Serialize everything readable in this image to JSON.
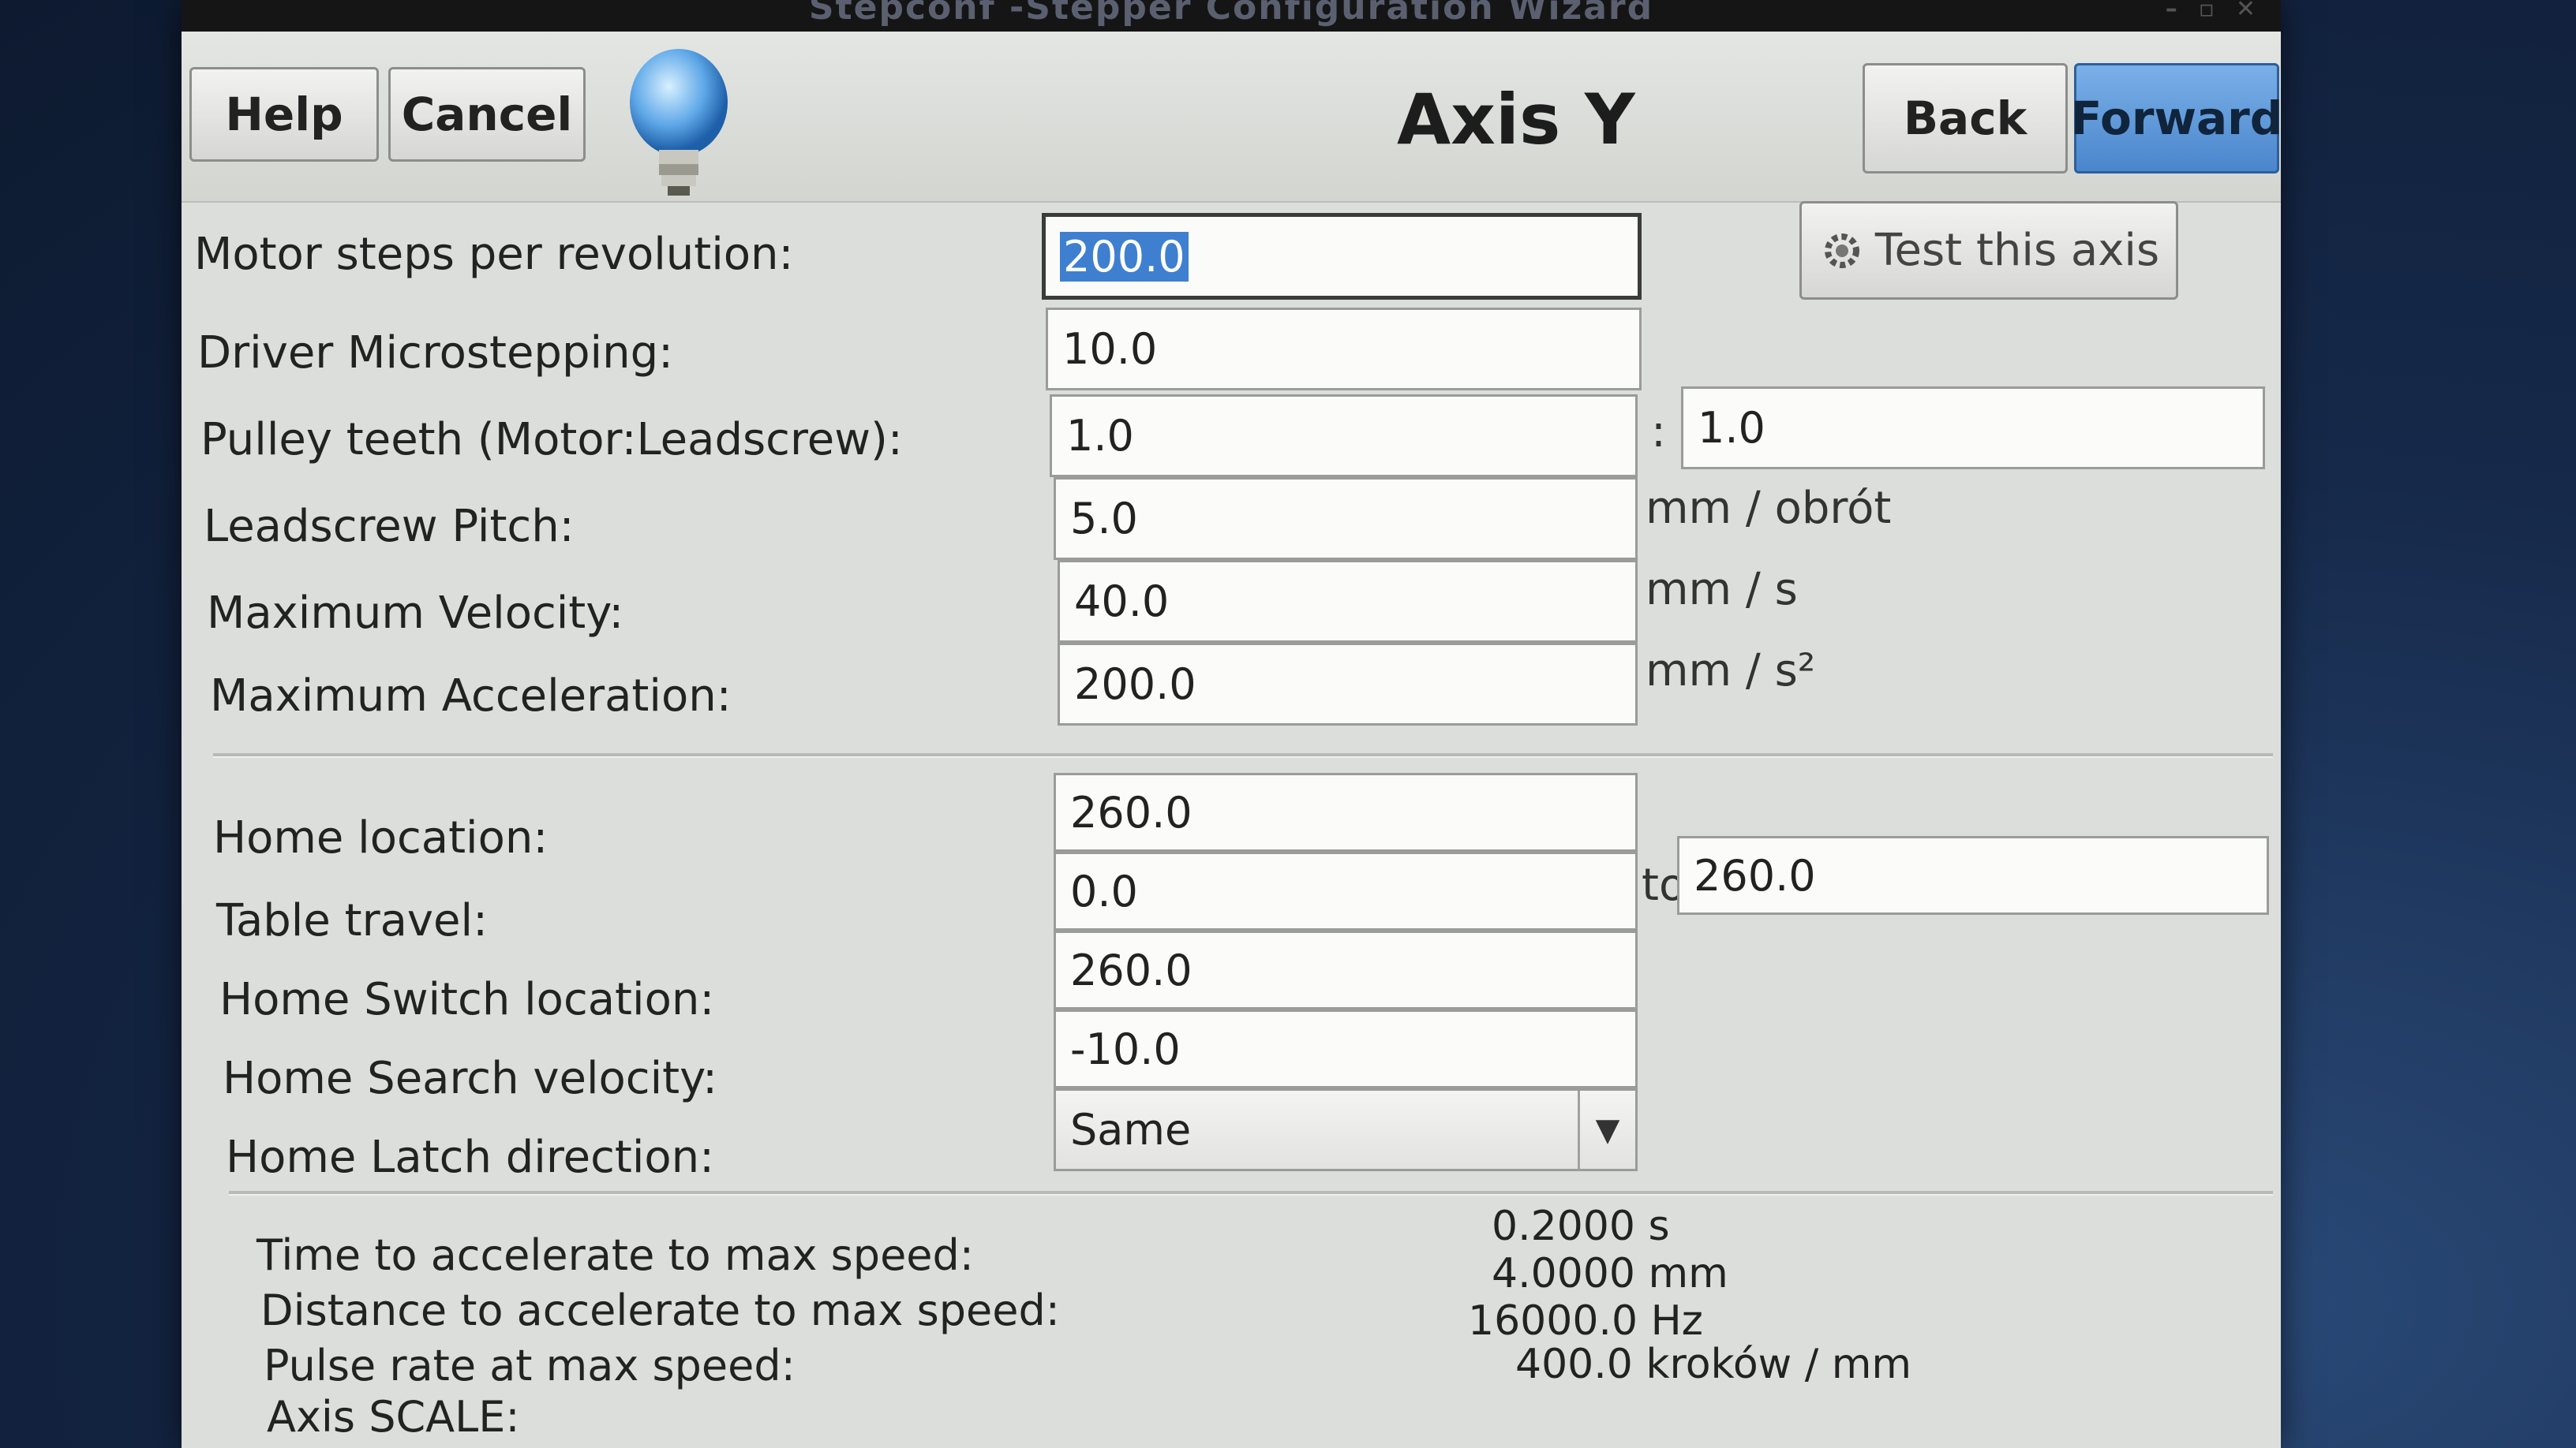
{
  "window": {
    "title": "Stepconf -Stepper Configuration Wizard",
    "controls": [
      "–",
      "▫",
      "✕"
    ]
  },
  "toolbar": {
    "help_label": "Help",
    "cancel_label": "Cancel",
    "page_title": "Axis Y",
    "back_label": "Back",
    "forward_label": "Forward",
    "test_axis_label": "Test this axis"
  },
  "motor": {
    "steps_label": "Motor steps per revolution:",
    "steps_value": "200.0",
    "microstep_label": "Driver Microstepping:",
    "microstep_value": "10.0",
    "pulley_label": "Pulley teeth (Motor:Leadscrew):",
    "pulley_motor": "1.0",
    "pulley_sep": ":",
    "pulley_leadscrew": "1.0",
    "pitch_label": "Leadscrew Pitch:",
    "pitch_value": "5.0",
    "pitch_unit": "mm / obrót",
    "velocity_label": "Maximum Velocity:",
    "velocity_value": "40.0",
    "velocity_unit": "mm / s",
    "accel_label": "Maximum Acceleration:",
    "accel_value": "200.0",
    "accel_unit": "mm / s²"
  },
  "homing": {
    "home_location_label": "Home location:",
    "home_location_value": "260.0",
    "travel_label": "Table travel:",
    "travel_from": "0.0",
    "travel_to_label": "to",
    "travel_to": "260.0",
    "switch_label": "Home Switch location:",
    "switch_value": "260.0",
    "search_label": "Home Search velocity:",
    "search_value": "-10.0",
    "latch_label": "Home Latch direction:",
    "latch_value": "Same"
  },
  "stats": {
    "time_label": "Time to accelerate to max speed:",
    "time_value": "0.2000 s",
    "dist_label": "Distance to accelerate to max speed:",
    "dist_value": "4.0000 mm",
    "pulse_label": "Pulse rate at max speed:",
    "pulse_value": "16000.0 Hz",
    "scale_label": "Axis SCALE:",
    "scale_value": "400.0 kroków / mm"
  }
}
